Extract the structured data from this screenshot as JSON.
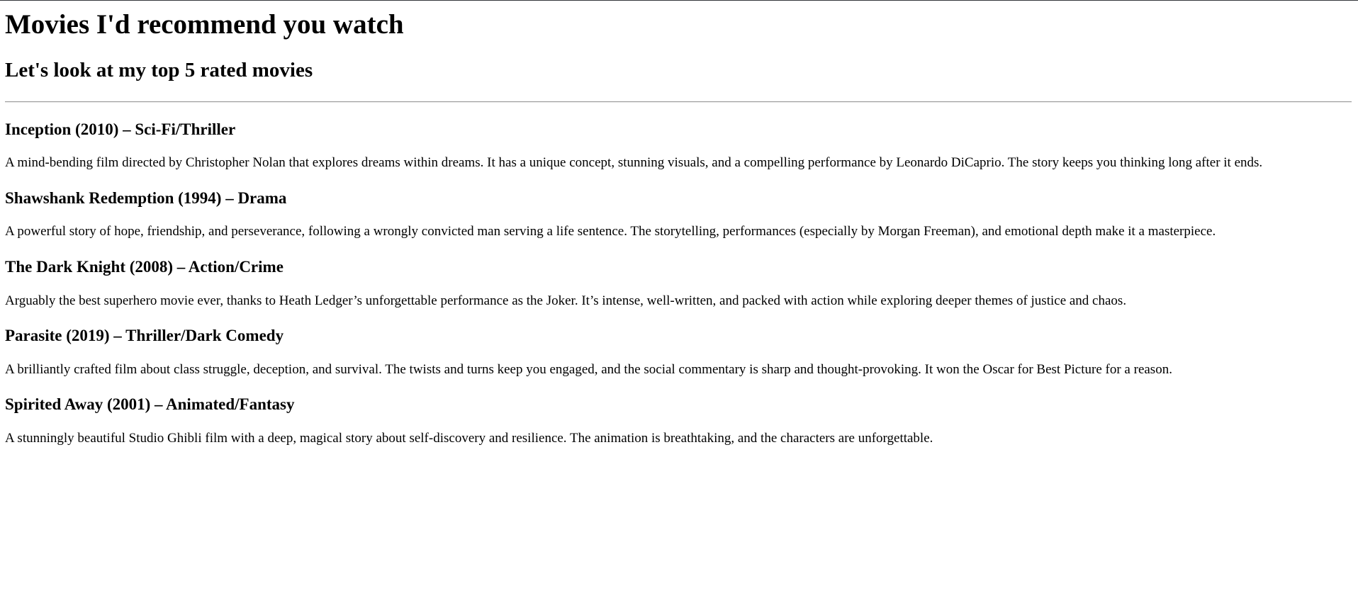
{
  "page": {
    "title": "Movies I'd recommend you watch",
    "subtitle": "Let's look at my top 5 rated movies"
  },
  "movies": [
    {
      "title": "Inception (2010) – Sci-Fi/Thriller",
      "description": "A mind-bending film directed by Christopher Nolan that explores dreams within dreams. It has a unique concept, stunning visuals, and a compelling performance by Leonardo DiCaprio. The story keeps you thinking long after it ends."
    },
    {
      "title": "Shawshank Redemption (1994) – Drama",
      "description": "A powerful story of hope, friendship, and perseverance, following a wrongly convicted man serving a life sentence. The storytelling, performances (especially by Morgan Freeman), and emotional depth make it a masterpiece."
    },
    {
      "title": "The Dark Knight (2008) – Action/Crime",
      "description": "Arguably the best superhero movie ever, thanks to Heath Ledger’s unforgettable performance as the Joker. It’s intense, well-written, and packed with action while exploring deeper themes of justice and chaos."
    },
    {
      "title": "Parasite (2019) – Thriller/Dark Comedy",
      "description": "A brilliantly crafted film about class struggle, deception, and survival. The twists and turns keep you engaged, and the social commentary is sharp and thought-provoking. It won the Oscar for Best Picture for a reason."
    },
    {
      "title": "Spirited Away (2001) – Animated/Fantasy",
      "description": "A stunningly beautiful Studio Ghibli film with a deep, magical story about self-discovery and resilience. The animation is breathtaking, and the characters are unforgettable."
    }
  ]
}
